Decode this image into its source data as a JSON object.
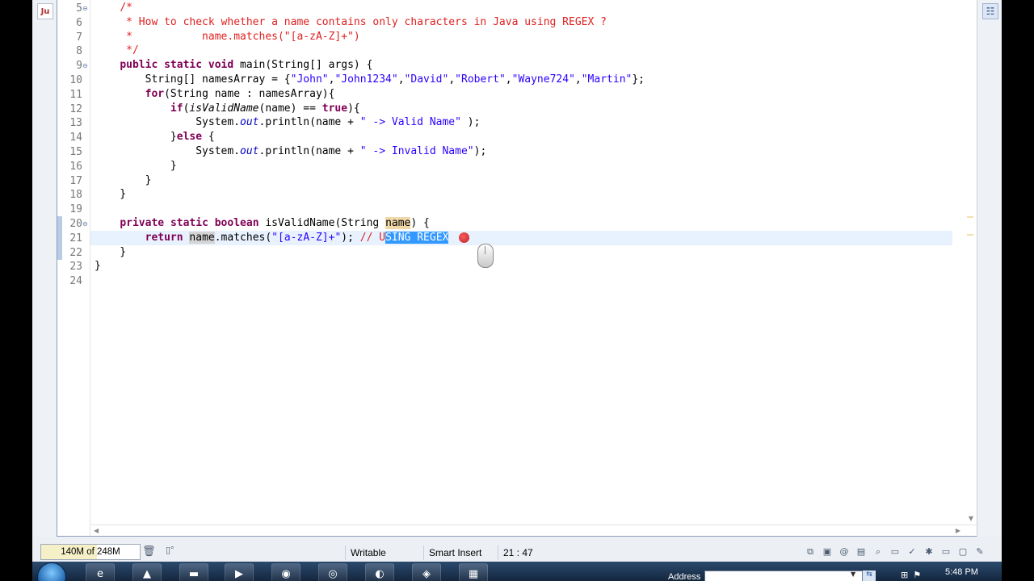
{
  "ide": {
    "left_panel_icon": "Ju",
    "right_panel_icon": "outline-icon"
  },
  "editor": {
    "lines": [
      {
        "n": "5",
        "fold": "⊖",
        "tokens": [
          {
            "t": "    "
          },
          {
            "t": "/*",
            "c": "cm"
          }
        ]
      },
      {
        "n": "6",
        "tokens": [
          {
            "t": "     "
          },
          {
            "t": "* How to check whether a name contains only characters in Java using REGEX ?",
            "c": "cm"
          }
        ]
      },
      {
        "n": "7",
        "tokens": [
          {
            "t": "     "
          },
          {
            "t": "*           name.matches(\"[a-zA-Z]+\")",
            "c": "cm"
          }
        ]
      },
      {
        "n": "8",
        "tokens": [
          {
            "t": "     "
          },
          {
            "t": "*/",
            "c": "cm"
          }
        ]
      },
      {
        "n": "9",
        "fold": "⊖",
        "tokens": [
          {
            "t": "    "
          },
          {
            "t": "public",
            "c": "kw"
          },
          {
            "t": " "
          },
          {
            "t": "static",
            "c": "kw"
          },
          {
            "t": " "
          },
          {
            "t": "void",
            "c": "kw"
          },
          {
            "t": " main(String[] args) {"
          }
        ]
      },
      {
        "n": "10",
        "tokens": [
          {
            "t": "        String[] namesArray = {"
          },
          {
            "t": "\"John\"",
            "c": "st"
          },
          {
            "t": ","
          },
          {
            "t": "\"John1234\"",
            "c": "st"
          },
          {
            "t": ","
          },
          {
            "t": "\"David\"",
            "c": "st"
          },
          {
            "t": ","
          },
          {
            "t": "\"Robert\"",
            "c": "st"
          },
          {
            "t": ","
          },
          {
            "t": "\"Wayne724\"",
            "c": "st"
          },
          {
            "t": ","
          },
          {
            "t": "\"Martin\"",
            "c": "st"
          },
          {
            "t": "};"
          }
        ]
      },
      {
        "n": "11",
        "tokens": [
          {
            "t": "        "
          },
          {
            "t": "for",
            "c": "kw"
          },
          {
            "t": "(String name : namesArray){"
          }
        ]
      },
      {
        "n": "12",
        "tokens": [
          {
            "t": "            "
          },
          {
            "t": "if",
            "c": "kw"
          },
          {
            "t": "("
          },
          {
            "t": "isValidName",
            "c": "it"
          },
          {
            "t": "(name) == "
          },
          {
            "t": "true",
            "c": "kw"
          },
          {
            "t": "){"
          }
        ]
      },
      {
        "n": "13",
        "tokens": [
          {
            "t": "                System."
          },
          {
            "t": "out",
            "c": "fld"
          },
          {
            "t": ".println(name + "
          },
          {
            "t": "\" -> Valid Name\"",
            "c": "st"
          },
          {
            "t": " );"
          }
        ]
      },
      {
        "n": "14",
        "tokens": [
          {
            "t": "            }"
          },
          {
            "t": "else",
            "c": "kw"
          },
          {
            "t": " {"
          }
        ]
      },
      {
        "n": "15",
        "tokens": [
          {
            "t": "                System."
          },
          {
            "t": "out",
            "c": "fld"
          },
          {
            "t": ".println(name + "
          },
          {
            "t": "\" -> Invalid Name\"",
            "c": "st"
          },
          {
            "t": ");"
          }
        ]
      },
      {
        "n": "16",
        "tokens": [
          {
            "t": "            }"
          }
        ]
      },
      {
        "n": "17",
        "tokens": [
          {
            "t": "        }"
          }
        ]
      },
      {
        "n": "18",
        "tokens": [
          {
            "t": "    }"
          }
        ]
      },
      {
        "n": "19",
        "tokens": []
      },
      {
        "n": "20",
        "fold": "⊖",
        "tokens": [
          {
            "t": "    "
          },
          {
            "t": "private",
            "c": "kw"
          },
          {
            "t": " "
          },
          {
            "t": "static",
            "c": "kw"
          },
          {
            "t": " "
          },
          {
            "t": "boolean",
            "c": "kw"
          },
          {
            "t": " isValidName(String "
          },
          {
            "t": "name",
            "c": "occw"
          },
          {
            "t": ") {"
          }
        ]
      },
      {
        "n": "21",
        "tokens": [
          {
            "t": "        "
          },
          {
            "t": "return",
            "c": "kw"
          },
          {
            "t": " "
          },
          {
            "t": "name",
            "c": "occ"
          },
          {
            "t": ".matches("
          },
          {
            "t": "\"[a-zA-Z]+\"",
            "c": "st"
          },
          {
            "t": "); "
          },
          {
            "t": "// U",
            "c": "cm"
          },
          {
            "t": "SING REGEX",
            "c": "sel"
          }
        ]
      },
      {
        "n": "22",
        "tokens": [
          {
            "t": "    }"
          }
        ]
      },
      {
        "n": "23",
        "tokens": [
          {
            "t": "}"
          }
        ]
      },
      {
        "n": "24",
        "tokens": []
      }
    ]
  },
  "status": {
    "heap": "140M of 248M",
    "heap_used_fraction": 0.5645,
    "writable": "Writable",
    "insert_mode": "Smart Insert",
    "position": "21 : 47"
  },
  "taskbar": {
    "address_label": "Address",
    "address_value": "",
    "clock": "5:48 PM"
  },
  "colors": {
    "keyword": "#7f0055",
    "comment": "#e02020",
    "string": "#2a00ff",
    "selection": "#3399ff",
    "current_line": "#e8f2fe"
  }
}
